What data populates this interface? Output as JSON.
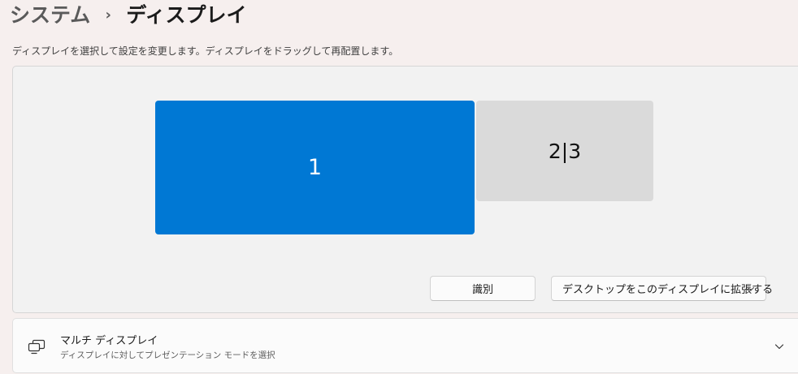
{
  "breadcrumb": {
    "parent": "システム",
    "separator": "›",
    "current": "ディスプレイ"
  },
  "description": "ディスプレイを選択して設定を変更します。ディスプレイをドラッグして再配置します。",
  "arrangement": {
    "monitors": [
      {
        "label": "1",
        "selected": true
      },
      {
        "label": "2|3",
        "selected": false
      }
    ],
    "identify_label": "識別",
    "mode_label": "デスクトップをこのディスプレイに拡張する",
    "mode_icon": "chevron-down-icon"
  },
  "multi_display": {
    "title": "マルチ ディスプレイ",
    "subtitle": "ディスプレイに対してプレゼンテーション モードを選択",
    "icon": "multi-monitor-icon",
    "expand_icon": "chevron-down-icon"
  },
  "colors": {
    "accent": "#0078d4",
    "unselected_monitor": "#dadada",
    "background": "#f6efee"
  }
}
